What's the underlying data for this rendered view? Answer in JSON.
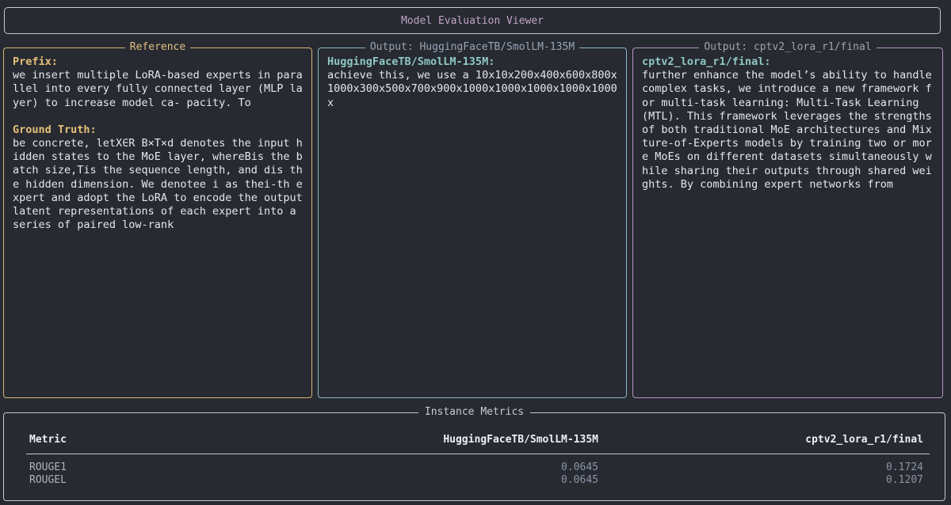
{
  "app": {
    "title": "Model Evaluation Viewer"
  },
  "reference": {
    "panel_title": "Reference",
    "prefix_label": "Prefix:",
    "prefix_text": "we insert multiple LoRA-based experts in parallel into every fully connected layer (MLP layer) to increase model ca- pacity. To",
    "ground_truth_label": "Ground Truth:",
    "ground_truth_text": "be concrete, letX∈R B×T×d denotes the input hidden states to the MoE layer, whereBis the batch size,Tis the sequence length, and dis the hidden dimension. We denotee i as thei-th expert and adopt the LoRA to encode the output latent representations of each expert into a series of paired low-rank"
  },
  "output_a": {
    "panel_title": "Output: HuggingFaceTB/SmolLM-135M",
    "model_label": "HuggingFaceTB/SmolLM-135M:",
    "text": "achieve this, we use a 10x10x200x400x600x800x1000x300x500x700x900x1000x1000x1000x1000x1000x"
  },
  "output_b": {
    "panel_title": "Output: cptv2_lora_r1/final",
    "model_label": "cptv2_lora_r1/final:",
    "text": "further enhance the model’s ability to handle complex tasks, we introduce a new framework for multi-task learning: Multi-Task Learning (MTL). This framework leverages the strengths of both traditional MoE architectures and Mixture-of-Experts models by training two or more MoEs on different datasets simultaneously while sharing their outputs through shared weights. By combining expert networks from"
  },
  "metrics": {
    "section_title": "Instance Metrics",
    "headers": [
      "Metric",
      "HuggingFaceTB/SmolLM-135M",
      "cptv2_lora_r1/final"
    ],
    "rows": [
      {
        "metric": "ROUGE1",
        "a": "0.0645",
        "b": "0.1724"
      },
      {
        "metric": "ROUGEL",
        "a": "0.0645",
        "b": "0.1207"
      }
    ]
  },
  "colors": {
    "background": "#272a31",
    "reference_border": "#d8b573",
    "output_a_border": "#8bb5c6",
    "output_b_border": "#b793c2",
    "title_text": "#c3a4c8"
  }
}
